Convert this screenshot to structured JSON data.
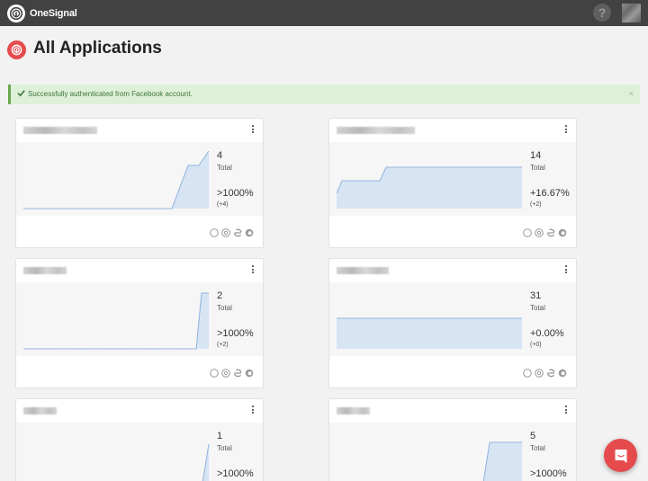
{
  "brand": {
    "name": "OneSignal"
  },
  "header": {
    "help_label": "?"
  },
  "page": {
    "title": "All Applications"
  },
  "alert": {
    "text": "Successfully authenticated from Facebook account.",
    "close": "×"
  },
  "labels": {
    "total": "Total"
  },
  "apps": [
    {
      "total": "4",
      "change": ">1000%",
      "delta": "(+4)"
    },
    {
      "total": "14",
      "change": "+16.67%",
      "delta": "(+2)"
    },
    {
      "total": "2",
      "change": ">1000%",
      "delta": "(+2)"
    },
    {
      "total": "31",
      "change": "+0.00%",
      "delta": "(+0)"
    },
    {
      "total": "1",
      "change": ">1000%",
      "delta": ""
    },
    {
      "total": "5",
      "change": ">1000%",
      "delta": ""
    }
  ],
  "colors": {
    "accent": "#e54b4d",
    "chart_fill": "#d6e4f3",
    "chart_line": "#8fb2de",
    "topbar": "#424242"
  },
  "icons": [
    "safari-icon",
    "chrome-icon",
    "edge-icon",
    "firefox-icon",
    "intercom-chat-icon"
  ]
}
